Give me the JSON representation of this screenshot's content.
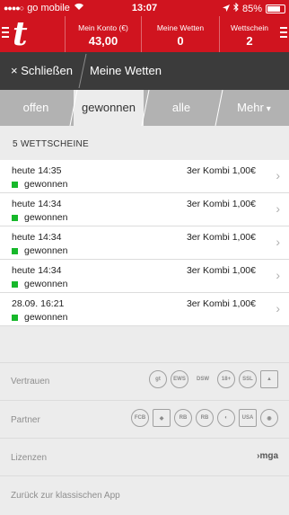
{
  "statusbar": {
    "carrier": "go mobile",
    "time": "13:07",
    "battery": "85%",
    "battery_level": 0.85
  },
  "header": {
    "logo": "t",
    "account_label": "Mein Konto (€)",
    "account_value": "43,00",
    "bets_label": "Meine Wetten",
    "bets_value": "0",
    "slip_label": "Wettschein",
    "slip_value": "2"
  },
  "closebar": {
    "close_label": "× Schließen",
    "title": "Meine Wetten"
  },
  "tabs": [
    "offen",
    "gewonnen",
    "alle",
    "Mehr"
  ],
  "list": {
    "count_label": "5 WETTSCHEINE",
    "rows": [
      {
        "date": "heute 14:35",
        "status": "gewonnen",
        "summary": "3er Kombi 1,00€"
      },
      {
        "date": "heute 14:34",
        "status": "gewonnen",
        "summary": "3er Kombi 1,00€"
      },
      {
        "date": "heute 14:34",
        "status": "gewonnen",
        "summary": "3er Kombi 1,00€"
      },
      {
        "date": "heute 14:34",
        "status": "gewonnen",
        "summary": "3er Kombi 1,00€"
      },
      {
        "date": "28.09. 16:21",
        "status": "gewonnen",
        "summary": "3er Kombi 1,00€"
      }
    ]
  },
  "footer": {
    "trust_label": "Vertrauen",
    "partner_label": "Partner",
    "license_label": "Lizenzen",
    "license_logo": "mga",
    "classic_label": "Zurück zur klassischen App"
  },
  "colors": {
    "brand_red": "#d0141f",
    "dark_bar": "#3b3b3b",
    "tab_grey": "#b2b2b2",
    "won_green": "#17b82b"
  }
}
